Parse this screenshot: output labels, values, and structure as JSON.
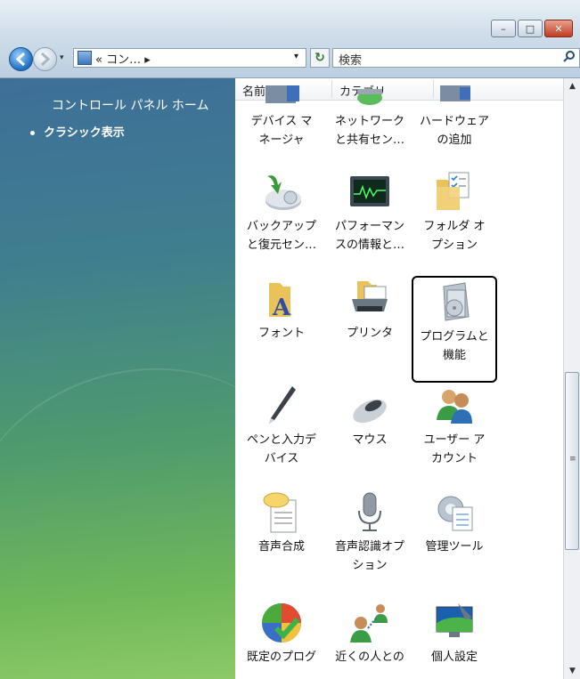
{
  "toolbar": {
    "address_text": "« コン…  ▸",
    "address_dropdown": "▾",
    "history_dropdown": "▾",
    "refresh_glyph": "↻",
    "search_placeholder": "検索",
    "search_glyph": "⚲"
  },
  "captions": {
    "minimize": "–",
    "maximize": "□",
    "close": "✕"
  },
  "sidebar": {
    "home_label": "コントロール パネル ホーム",
    "classic_label": "クラシック表示"
  },
  "columns": {
    "name": "名前",
    "category": "カテゴリ",
    "sort_glyph": "ˆ"
  },
  "items": [
    {
      "line1": "デバイス マ",
      "line2": "ネージャ"
    },
    {
      "line1": "ネットワーク",
      "line2": "と共有セン…"
    },
    {
      "line1": "ハードウェア",
      "line2": "の追加"
    },
    {
      "line1": "バックアップ",
      "line2": "と復元セン…"
    },
    {
      "line1": "パフォーマン",
      "line2": "スの情報と…"
    },
    {
      "line1": "フォルダ オ",
      "line2": "プション"
    },
    {
      "line1": "フォント",
      "line2": ""
    },
    {
      "line1": "プリンタ",
      "line2": ""
    },
    {
      "line1": "プログラムと",
      "line2": "機能"
    },
    {
      "line1": "ペンと入力デ",
      "line2": "バイス"
    },
    {
      "line1": "マウス",
      "line2": ""
    },
    {
      "line1": "ユーザー ア",
      "line2": "カウント"
    },
    {
      "line1": "音声合成",
      "line2": ""
    },
    {
      "line1": "音声認識オプ",
      "line2": "ション"
    },
    {
      "line1": "管理ツール",
      "line2": ""
    },
    {
      "line1": "既定のプログ",
      "line2": ""
    },
    {
      "line1": "近くの人との",
      "line2": ""
    },
    {
      "line1": "個人設定",
      "line2": ""
    }
  ],
  "scrollbar": {
    "up": "▲",
    "down": "▼",
    "grip": "≡"
  },
  "selected_item": "プログラムと機能"
}
